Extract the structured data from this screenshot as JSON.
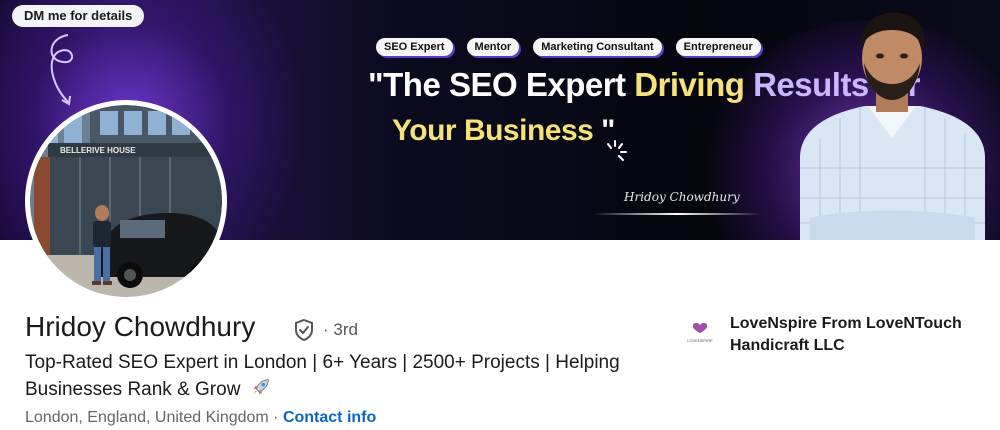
{
  "banner": {
    "dm_pill": "DM me for details",
    "tags": [
      "SEO Expert",
      "Mentor",
      "Marketing Consultant",
      "Entrepreneur"
    ],
    "headline_line1_open": "\"The SEO Expert ",
    "headline_line1_mid": "Driving ",
    "headline_line1_end": "Results for",
    "headline_line2": "Your Business",
    "headline_line2_close": " \"",
    "signature": "Hridoy Chowdhury"
  },
  "avatar_building_sign": "BELLERIVE HOUSE",
  "profile": {
    "name": "Hridoy Chowdhury",
    "degree": "· 3rd",
    "headline_line1": "Top-Rated SEO Expert in London | 6+ Years | 2500+ Projects | Helping",
    "headline_line2": "Businesses Rank & Grow",
    "location": "London, England, United Kingdom",
    "location_sep": " · ",
    "contact_info": "Contact info"
  },
  "company": {
    "logo_text": "LOVENSPIRE",
    "name_line1": "LoveNspire From LoveNTouch",
    "name_line2": "Handicraft LLC"
  },
  "colors": {
    "link": "#0a66c2",
    "text": "#1b1b1b",
    "muted": "#666666",
    "banner_accent": "#6b35c8"
  },
  "icons": {
    "verify": "verified-shield-icon",
    "emoji": "rocket-icon"
  }
}
